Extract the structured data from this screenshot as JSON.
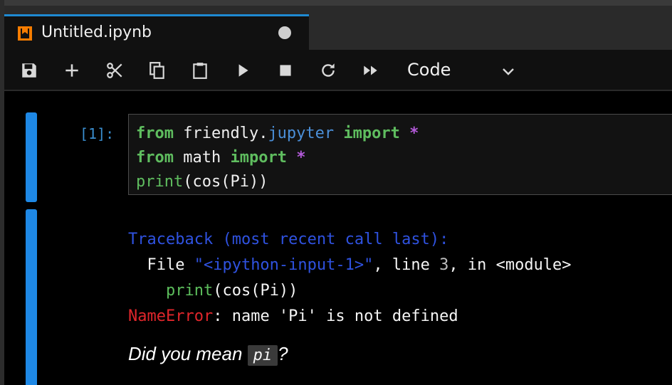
{
  "tab": {
    "title": "Untitled.ipynb",
    "icon": "notebook-icon",
    "unsaved_indicator": "unsaved-dot"
  },
  "toolbar": {
    "buttons": [
      "save-icon",
      "add-icon",
      "cut-icon",
      "copy-icon",
      "paste-icon",
      "run-icon",
      "stop-icon",
      "restart-icon",
      "run-all-icon"
    ],
    "cell_type": "Code"
  },
  "cell": {
    "prompt": "[1]:",
    "code": [
      [
        "from",
        " friendly.",
        "jupyter",
        " ",
        "import",
        " ",
        "*"
      ],
      [
        "from",
        " math ",
        "import",
        " ",
        "*"
      ],
      [
        "print",
        "(cos(Pi))"
      ]
    ]
  },
  "output": {
    "traceback_header": "Traceback (most recent call last):",
    "file_prefix": "  File ",
    "file_name": "\"<ipython-input-1>\"",
    "file_mid": ", line ",
    "line_no": "3",
    "file_suffix": ", in <module>",
    "src_indent": "    ",
    "src_func": "print",
    "src_rest": "(cos(Pi))",
    "error_name": "NameError",
    "error_msg": ": name 'Pi' is not defined",
    "hint_prefix": "Did you mean ",
    "hint_code": "pi",
    "hint_suffix": "?"
  },
  "colors": {
    "accent": "#1e88e5",
    "keyword": "#5fbd5f",
    "error": "#e0262b",
    "traceback": "#2f52e0"
  }
}
